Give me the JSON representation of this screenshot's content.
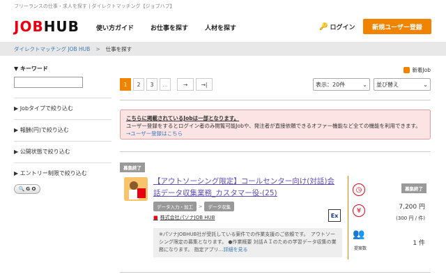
{
  "topline": "フリーランスの仕事・求人を探す | ダイレクトマッチング【ジョブハブ】",
  "logo": {
    "part1": "JOB",
    "part2": "HUB"
  },
  "nav": {
    "guide": "使い方ガイド",
    "find_work": "お仕事を探す",
    "find_talent": "人材を探す",
    "login": "ログイン",
    "register": "新規ユーザー登録"
  },
  "breadcrumb": {
    "home": "ダイレクトマッチング JOB HUB",
    "sep": ">",
    "current": "仕事を探す"
  },
  "sidebar": {
    "keyword": "▼ キーワード",
    "filters": [
      "▶ Jobタイプで絞り込む",
      "▶ 報酬(円)で絞り込む",
      "▶ 公開状態で絞り込む",
      "▶ エントリー制限で絞り込む"
    ],
    "go": "G O"
  },
  "main": {
    "new_job": "新着Job",
    "pages": [
      "1",
      "2",
      "3",
      "..."
    ],
    "next": "→",
    "last": "→|",
    "display": "表示：20件",
    "sort": "並び替え",
    "notice_title": "こちらに掲載されているJobは一部となります。",
    "notice_body": "ユーザー登録をするとログイン者のみ閲覧可能Jobや、発注者が直接依頼できるオファー機能など全ての機能を利用できます。",
    "notice_link": "ユーザー登録はこちら"
  },
  "job": {
    "status": "募集終了",
    "title": "【アウトソーシング限定】コールセンター向け(対話)会話データ収集業務_カスタマー役-(25)",
    "tag1": "データ入力・加工",
    "tag_sep": ">",
    "tag2": "データ収集",
    "company": "株式会社パソナJOB HUB",
    "ex": "Ex",
    "description": "※パソナJOBHUB社が受託している案件での作業支援のご依頼です。　アウトソーシング限定の募集となります。 ●作業概要 対話ＡＩのための学習データ収集の業務になります。 指定アプリ…",
    "more": "詳細を見る",
    "right_status": "募集終了",
    "price": "7,200 円",
    "per": "(300 円 / 件)",
    "proposals_label": "提案数",
    "proposals": "1 件"
  }
}
